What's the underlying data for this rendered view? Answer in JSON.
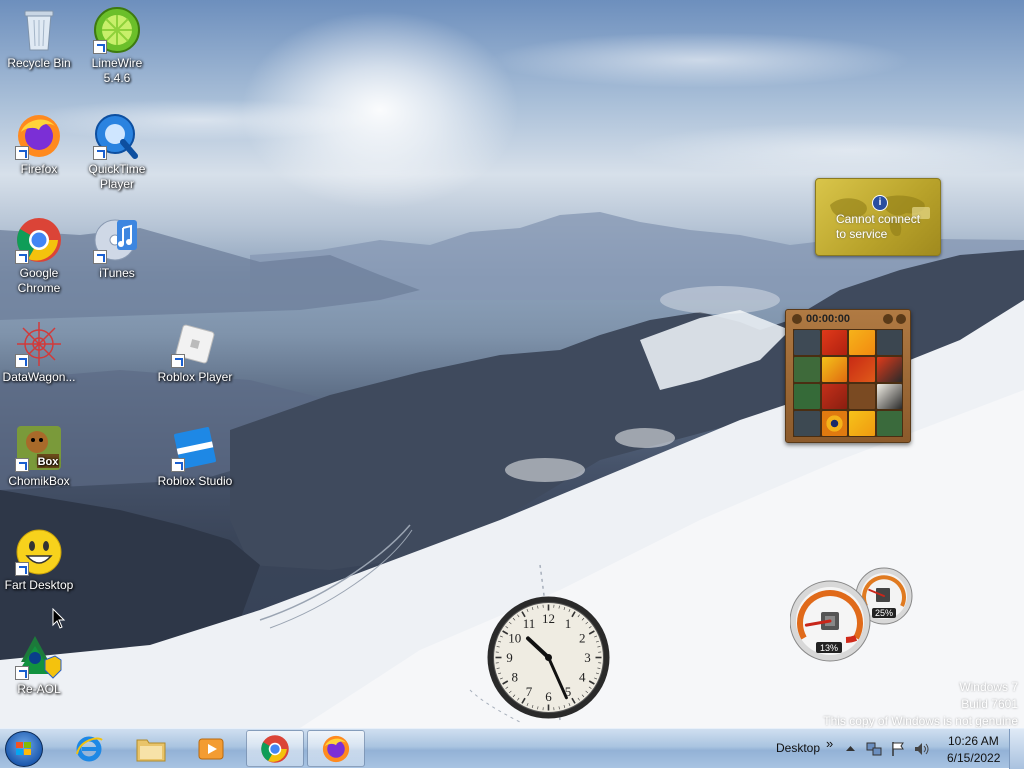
{
  "desktop": {
    "icons": [
      {
        "label": "Recycle Bin",
        "icon": "recycle-bin-icon"
      },
      {
        "label": "LimeWire 5.4.6",
        "line1": "LimeWire",
        "line2": "5.4.6",
        "icon": "limewire-icon"
      },
      {
        "label": "Firefox",
        "icon": "firefox-icon"
      },
      {
        "label": "QuickTime Player",
        "line1": "QuickTime",
        "line2": "Player",
        "icon": "quicktime-icon"
      },
      {
        "label": "Google Chrome",
        "line1": "Google",
        "line2": "Chrome",
        "icon": "chrome-icon"
      },
      {
        "label": "iTunes",
        "icon": "itunes-icon"
      },
      {
        "label": "DataWagon...",
        "icon": "datawagon-icon"
      },
      {
        "label": "Roblox Player",
        "icon": "roblox-player-icon"
      },
      {
        "label": "ChomikBox",
        "icon": "chomikbox-icon"
      },
      {
        "label": "Roblox Studio",
        "icon": "roblox-studio-icon"
      },
      {
        "label": "Fart Desktop",
        "icon": "smiley-icon"
      },
      {
        "label": "Re-AOL",
        "icon": "re-aol-icon"
      }
    ]
  },
  "gadgets": {
    "weather": {
      "message_line1": "Cannot connect",
      "message_line2": "to service",
      "info_glyph": "i"
    },
    "puzzle": {
      "timer": "00:00:00"
    },
    "clock": {
      "numerals": [
        "12",
        "1",
        "2",
        "3",
        "4",
        "5",
        "6",
        "7",
        "8",
        "9",
        "10",
        "11"
      ],
      "hour": 10,
      "minute": 26
    },
    "cpu_meter": {
      "cpu_percent": "13%",
      "memory_percent": "25%",
      "cpu_value": 13,
      "memory_value": 25
    }
  },
  "watermark": {
    "line1": "Windows 7",
    "line2": "Build 7601",
    "line3": "This copy of Windows is not genuine"
  },
  "taskbar": {
    "pinned": [
      {
        "name": "internet-explorer",
        "icon": "ie-icon"
      },
      {
        "name": "windows-explorer",
        "icon": "folder-icon"
      },
      {
        "name": "media-player",
        "icon": "media-player-icon"
      },
      {
        "name": "google-chrome",
        "icon": "chrome-icon"
      },
      {
        "name": "firefox",
        "icon": "firefox-icon"
      }
    ],
    "desktop_toolbar": "Desktop",
    "chevron": "»",
    "clock_time": "10:26 AM",
    "clock_date": "6/15/2022"
  }
}
